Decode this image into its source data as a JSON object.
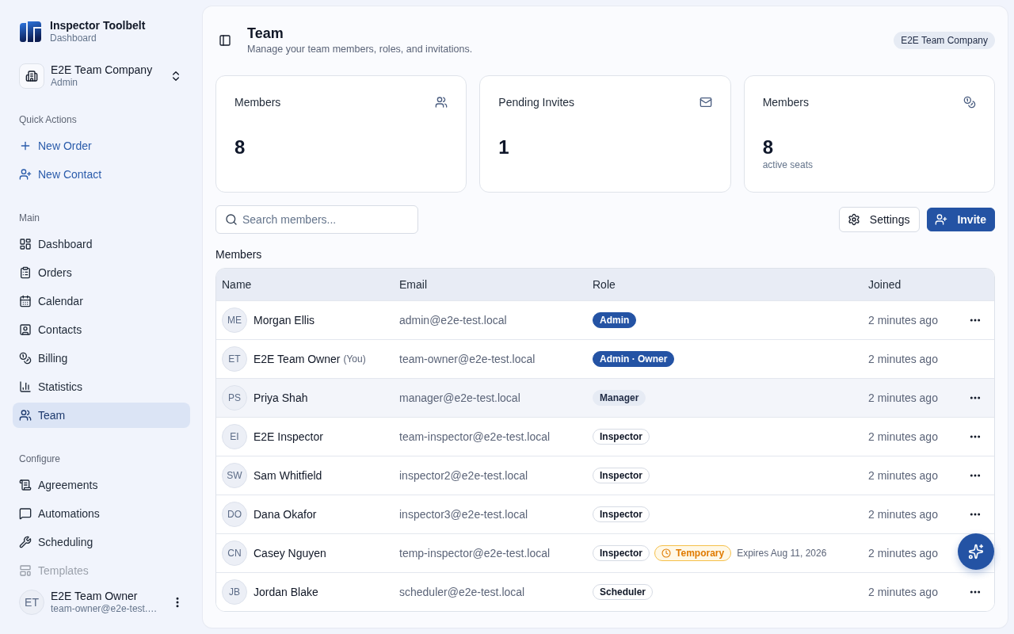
{
  "sidebar": {
    "app": {
      "title": "Inspector Toolbelt",
      "subtitle": "Dashboard"
    },
    "workspace": {
      "name": "E2E Team Company",
      "role": "Admin"
    },
    "sections": [
      {
        "heading": "Quick Actions",
        "kind": "actions",
        "items": [
          {
            "label": "New Order"
          },
          {
            "label": "New Contact"
          }
        ]
      },
      {
        "heading": "Main",
        "kind": "nav",
        "items": [
          {
            "label": "Dashboard",
            "selected": false,
            "dimmed": false
          },
          {
            "label": "Orders",
            "selected": false,
            "dimmed": false
          },
          {
            "label": "Calendar",
            "selected": false,
            "dimmed": false
          },
          {
            "label": "Contacts",
            "selected": false,
            "dimmed": false
          },
          {
            "label": "Billing",
            "selected": false,
            "dimmed": false
          },
          {
            "label": "Statistics",
            "selected": false,
            "dimmed": false
          },
          {
            "label": "Team",
            "selected": true,
            "dimmed": false
          }
        ]
      },
      {
        "heading": "Configure",
        "kind": "nav",
        "items": [
          {
            "label": "Agreements",
            "selected": false,
            "dimmed": false
          },
          {
            "label": "Automations",
            "selected": false,
            "dimmed": false
          },
          {
            "label": "Scheduling",
            "selected": false,
            "dimmed": false
          },
          {
            "label": "Templates",
            "selected": false,
            "dimmed": true
          }
        ]
      }
    ],
    "user": {
      "initials": "ET",
      "name": "E2E Team Owner",
      "email": "team-owner@e2e-test.…"
    }
  },
  "header": {
    "title": "Team",
    "subtitle": "Manage your team members, roles, and invitations.",
    "company_badge": "E2E Team Company"
  },
  "stats": [
    {
      "label": "Members",
      "value": "8"
    },
    {
      "label": "Pending Invites",
      "value": "1"
    },
    {
      "label": "Members",
      "value": "8",
      "note": "active seats"
    }
  ],
  "toolbar": {
    "search": {
      "placeholder": "Search members..."
    },
    "buttons": [
      {
        "label": "Settings",
        "kind": "secondary"
      },
      {
        "label": "Invite",
        "kind": "primary"
      }
    ]
  },
  "members": {
    "heading": "Members",
    "columns": [
      "Name",
      "Email",
      "Role",
      "Joined"
    ],
    "rows": [
      {
        "initials": "ME",
        "name": "Morgan Ellis",
        "email": "admin@e2e-test.local",
        "roles": [
          {
            "label": "Admin",
            "kind": "solid"
          }
        ],
        "joined": "2 minutes ago",
        "menu": true,
        "hovered": false
      },
      {
        "initials": "ET",
        "name": "E2E Team Owner",
        "note": "(You)",
        "email": "team-owner@e2e-test.local",
        "roles": [
          {
            "label": "Admin · Owner",
            "kind": "solid"
          }
        ],
        "joined": "2 minutes ago",
        "menu": false,
        "hovered": false
      },
      {
        "initials": "PS",
        "name": "Priya Shah",
        "email": "manager@e2e-test.local",
        "roles": [
          {
            "label": "Manager",
            "kind": "soft"
          }
        ],
        "joined": "2 minutes ago",
        "menu": true,
        "hovered": true
      },
      {
        "initials": "EI",
        "name": "E2E Inspector",
        "email": "team-inspector@e2e-test.local",
        "roles": [
          {
            "label": "Inspector",
            "kind": "outline"
          }
        ],
        "joined": "2 minutes ago",
        "menu": true,
        "hovered": false
      },
      {
        "initials": "SW",
        "name": "Sam Whitfield",
        "email": "inspector2@e2e-test.local",
        "roles": [
          {
            "label": "Inspector",
            "kind": "outline"
          }
        ],
        "joined": "2 minutes ago",
        "menu": true,
        "hovered": false
      },
      {
        "initials": "DO",
        "name": "Dana Okafor",
        "email": "inspector3@e2e-test.local",
        "roles": [
          {
            "label": "Inspector",
            "kind": "outline"
          }
        ],
        "joined": "2 minutes ago",
        "menu": true,
        "hovered": false
      },
      {
        "initials": "CN",
        "name": "Casey Nguyen",
        "email": "temp-inspector@e2e-test.local",
        "roles": [
          {
            "label": "Inspector",
            "kind": "outline"
          },
          {
            "label": "Temporary",
            "kind": "warning"
          }
        ],
        "expires": "Expires Aug 11, 2026",
        "joined": "2 minutes ago",
        "menu": false,
        "hovered": false
      },
      {
        "initials": "JB",
        "name": "Jordan Blake",
        "email": "scheduler@e2e-test.local",
        "roles": [
          {
            "label": "Scheduler",
            "kind": "outline"
          }
        ],
        "joined": "2 minutes ago",
        "menu": true,
        "hovered": false
      }
    ]
  }
}
